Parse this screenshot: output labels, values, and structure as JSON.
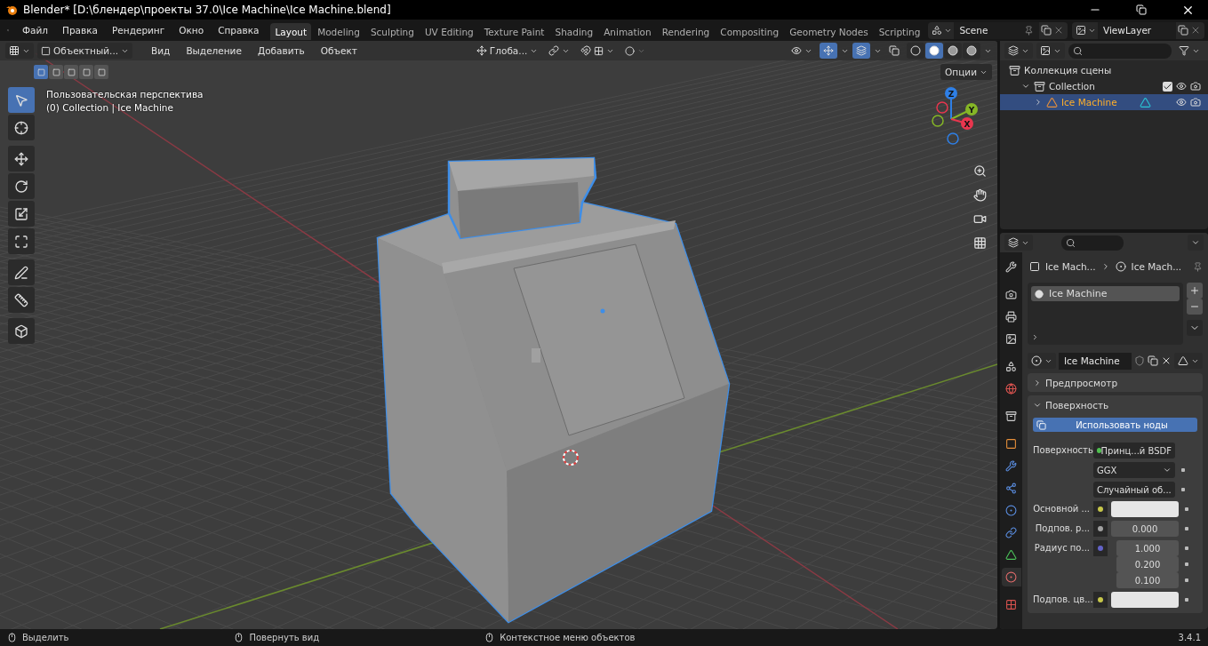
{
  "window": {
    "title": "Blender* [D:\\блендер\\проекты 37.0\\Ice Machine\\Ice Machine.blend]"
  },
  "menu": [
    "Файл",
    "Правка",
    "Рендеринг",
    "Окно",
    "Справка"
  ],
  "workspaces": [
    {
      "label": "Layout",
      "selected": true
    },
    {
      "label": "Modeling",
      "selected": false
    },
    {
      "label": "Sculpting",
      "selected": false
    },
    {
      "label": "UV Editing",
      "selected": false
    },
    {
      "label": "Texture Paint",
      "selected": false
    },
    {
      "label": "Shading",
      "selected": false
    },
    {
      "label": "Animation",
      "selected": false
    },
    {
      "label": "Rendering",
      "selected": false
    },
    {
      "label": "Compositing",
      "selected": false
    },
    {
      "label": "Geometry Nodes",
      "selected": false
    },
    {
      "label": "Scripting",
      "selected": false
    }
  ],
  "scene": {
    "value": "Scene"
  },
  "view_layer": {
    "value": "ViewLayer"
  },
  "viewport": {
    "mode": "Объектный...",
    "menus": [
      "Вид",
      "Выделение",
      "Добавить",
      "Объект"
    ],
    "orientation": "Глоба...",
    "gizmos_on": true,
    "overlays_on": true,
    "shading_modes": [
      {
        "selected": false
      },
      {
        "selected": true
      },
      {
        "selected": false
      },
      {
        "selected": false
      }
    ],
    "select_modes": [
      {
        "selected": true
      },
      {
        "selected": false
      },
      {
        "selected": false
      },
      {
        "selected": false
      },
      {
        "selected": false
      }
    ],
    "options": "Опции",
    "info": [
      "Пользовательская перспектива",
      "(0) Collection | Ice Machine"
    ],
    "tools": [
      {
        "selected": true
      },
      {
        "selected": false
      },
      {
        "selected": false
      },
      {
        "selected": false
      },
      {
        "selected": false
      },
      {
        "selected": false
      },
      {
        "selected": false
      },
      {
        "selected": false
      },
      {
        "selected": false
      }
    ],
    "axes": [
      {
        "label": "Z",
        "color": "#2e7fe6"
      },
      {
        "label": "Y",
        "color": "#85b626"
      },
      {
        "label": "X",
        "color": "#e8364e"
      }
    ]
  },
  "outliner": {
    "items": [
      {
        "label": "Коллекция сцены",
        "selected": false,
        "children": [
          {
            "label": "Collection",
            "expanded": true,
            "checked": true,
            "selected": false,
            "children": [
              {
                "label": "Ice Machine",
                "expanded": false,
                "selected": true
              }
            ]
          }
        ]
      }
    ]
  },
  "properties": {
    "tabs": [
      {
        "selected": false
      },
      {
        "selected": false
      },
      {
        "selected": false
      },
      {
        "selected": false
      },
      {
        "selected": false
      },
      {
        "selected": false
      },
      {
        "selected": false
      },
      {
        "selected": false
      },
      {
        "selected": false
      },
      {
        "selected": false
      },
      {
        "selected": false
      },
      {
        "selected": false
      },
      {
        "selected": false
      },
      {
        "selected": true
      },
      {
        "selected": false
      }
    ],
    "breadcrumb": [
      "Ice Mach...",
      "Ice Mach..."
    ],
    "slots": [
      {
        "label": "Ice Machine",
        "selected": true
      }
    ],
    "material": "Ice Machine",
    "panels": [
      {
        "title": "Предпросмотр",
        "expanded": false
      },
      {
        "title": "Поверхность",
        "expanded": true
      }
    ],
    "use_nodes": "Использовать ноды",
    "fields": [
      {
        "kind": "link",
        "label": "Поверхность",
        "value": "Принц...й BSDF",
        "color": "#4fbf4f"
      },
      {
        "kind": "dropdown",
        "value": "GGX"
      },
      {
        "kind": "dropdown",
        "value": "Случайный об..."
      },
      {
        "kind": "color",
        "label": "Основной ...",
        "color": "#c7c74a"
      },
      {
        "kind": "number",
        "label": "Подпов. р...",
        "color": "#a1a1a1",
        "values": [
          "0.000"
        ]
      },
      {
        "kind": "number",
        "label": "Радиус по...",
        "color": "#6363c7",
        "values": [
          "1.000",
          "0.200",
          "0.100"
        ]
      },
      {
        "kind": "color",
        "label": "Подпов. цв...",
        "color": "#c7c74a"
      }
    ]
  },
  "status_bar": {
    "hints": [
      "Выделить",
      "Повернуть вид",
      "Контекстное меню объектов"
    ],
    "version": "3.4.1"
  }
}
